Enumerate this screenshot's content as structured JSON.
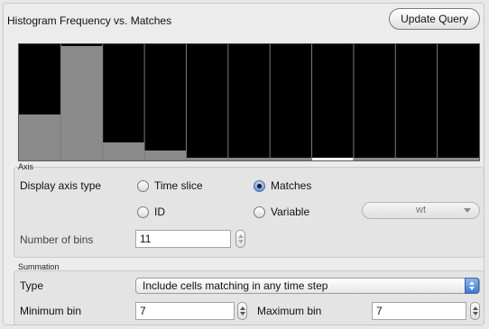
{
  "header": {
    "title": "Histogram  Frequency vs. Matches",
    "update_button": "Update Query"
  },
  "histogram": {
    "bin_count": 11,
    "bin_values": [
      0.4,
      1.0,
      0.16,
      0.09,
      0.02,
      0.02,
      0.02,
      0.02,
      0.02,
      0.02,
      0.02
    ],
    "highlighted_bin": 7,
    "colors": {
      "background": "#000000",
      "bar": "#8a8a8a",
      "separator": "#7a7a7a",
      "highlight": "#ffffff"
    }
  },
  "axis": {
    "section_label": "Axis",
    "display_axis_type_label": "Display axis type",
    "options": {
      "time_slice": "Time slice",
      "matches": "Matches",
      "id": "ID",
      "variable": "Variable"
    },
    "selected": "matches",
    "variable_select": "wt",
    "number_of_bins_label": "Number of bins",
    "number_of_bins": "11"
  },
  "summation": {
    "section_label": "Summation",
    "type_label": "Type",
    "type_value": "Include cells matching in any time step",
    "minimum_bin_label": "Minimum bin",
    "minimum_bin": "7",
    "maximum_bin_label": "Maximum bin",
    "maximum_bin": "7"
  }
}
